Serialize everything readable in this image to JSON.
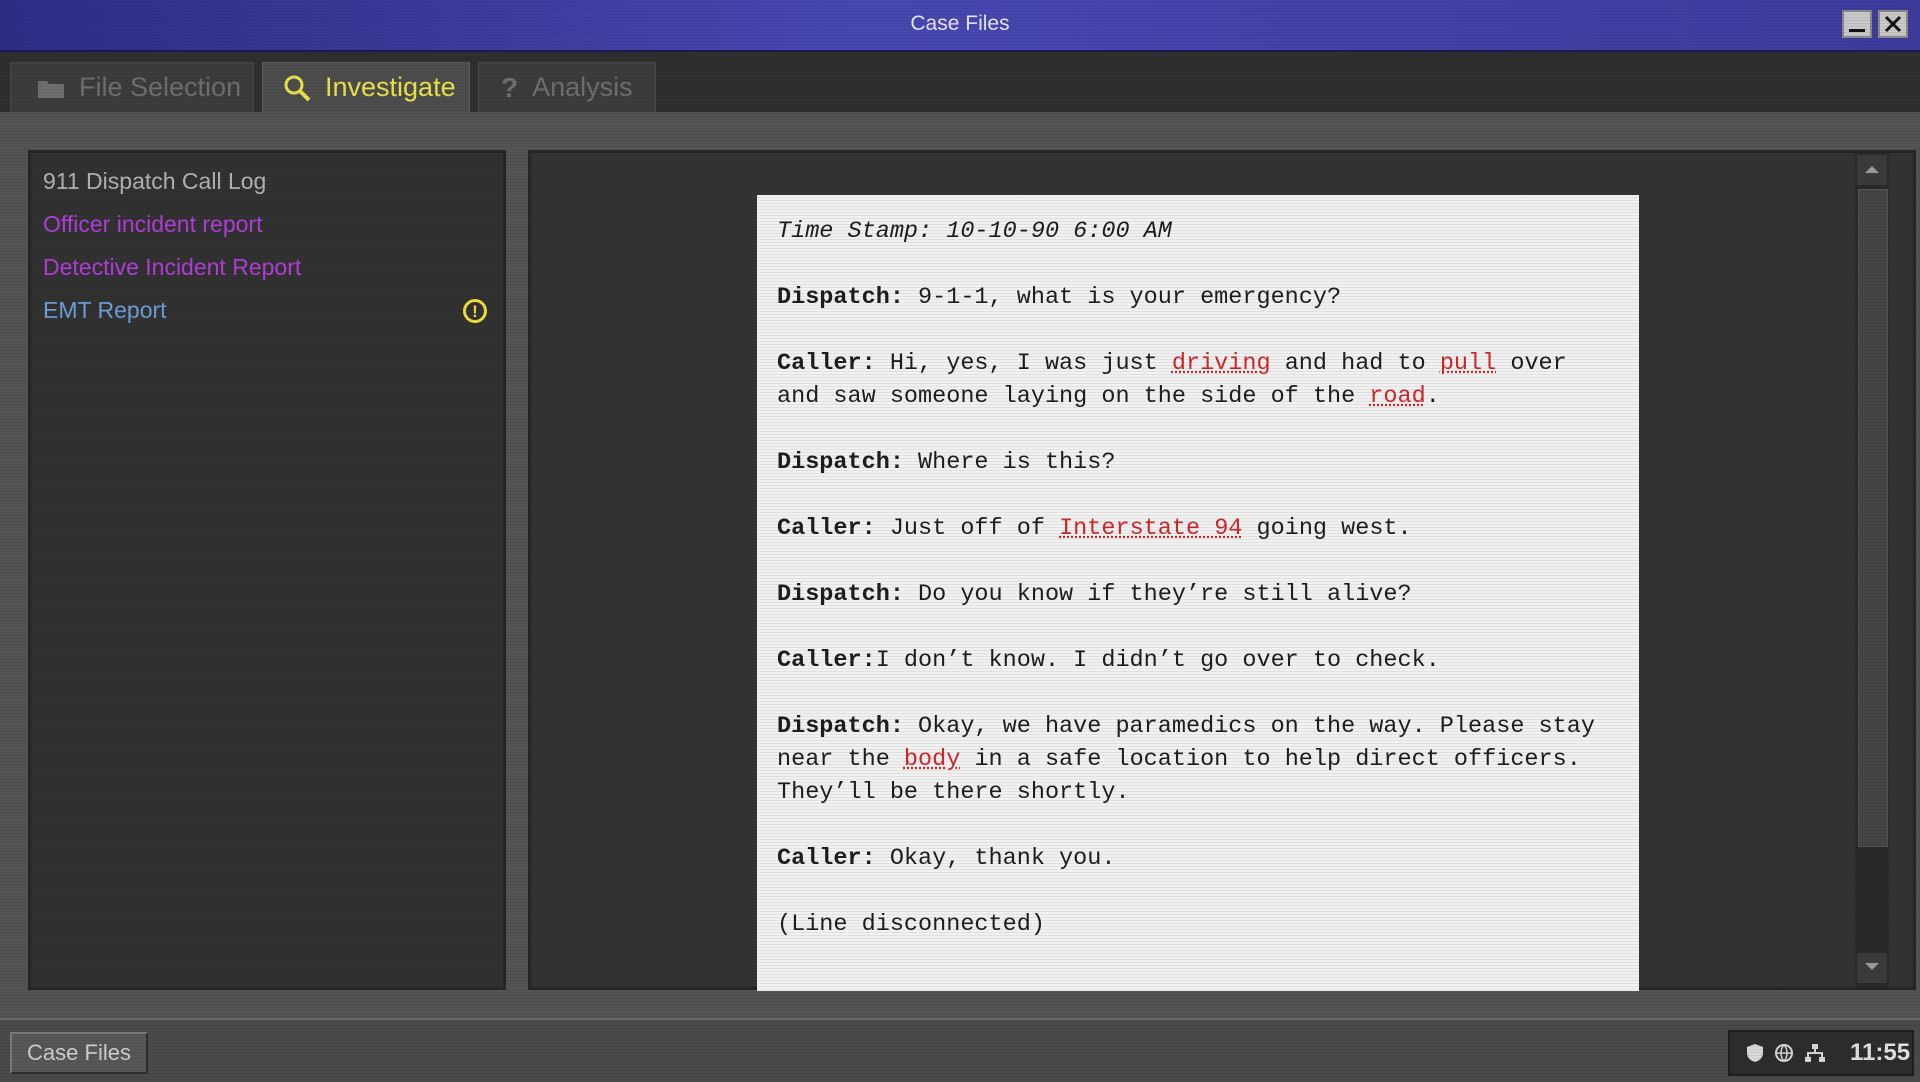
{
  "window": {
    "title": "Case Files"
  },
  "tabs": [
    {
      "label": "File Selection",
      "icon": "folder-icon",
      "active": false
    },
    {
      "label": "Investigate",
      "icon": "magnifier-icon",
      "active": true
    },
    {
      "label": "Analysis",
      "icon": "question-icon",
      "active": false
    }
  ],
  "files": [
    {
      "label": "911 Dispatch Call Log",
      "color": "#b3b3b3"
    },
    {
      "label": "Officer incident report",
      "color": "#b23ed8"
    },
    {
      "label": "Detective Incident Report",
      "color": "#b23ed8"
    },
    {
      "label": "EMT Report",
      "color": "#6f9fd8",
      "alert": "!"
    }
  ],
  "document": {
    "timestamp": "Time Stamp: 10-10-90 6:00 AM",
    "lines": [
      {
        "speaker": "Dispatch:",
        "parts": [
          " 9-1-1, what is your emergency?"
        ]
      },
      {
        "speaker": "Caller:",
        "parts": [
          " Hi, yes, I was just ",
          "driving",
          " and had to ",
          "pull",
          " over and saw someone laying on the side of the ",
          "road",
          "."
        ]
      },
      {
        "speaker": "Dispatch:",
        "parts": [
          " Where is this?"
        ]
      },
      {
        "speaker": "Caller:",
        "parts": [
          " Just off of ",
          "Interstate 94",
          " going west."
        ]
      },
      {
        "speaker": "Dispatch:",
        "parts": [
          " Do you know if they’re still alive?"
        ]
      },
      {
        "speaker": "Caller:",
        "parts": [
          "I don’t know. I didn’t go over to check."
        ]
      },
      {
        "speaker": "Dispatch:",
        "parts": [
          " Okay, we have paramedics on the way. Please stay near the ",
          "body",
          " in a safe location to help direct officers. They’ll be there shortly."
        ]
      },
      {
        "speaker": "Caller:",
        "parts": [
          " Okay, thank you."
        ]
      }
    ],
    "closing": "(Line disconnected)",
    "highlight_color": "#d1262a"
  },
  "taskbar": {
    "button_label": "Case Files",
    "tray_icons": [
      "shield-icon",
      "globe-icon",
      "network-icon"
    ],
    "clock": "11:55"
  },
  "colors": {
    "titlebar": "#3d3c9e",
    "active_tab_text": "#ece34a",
    "alert": "#ecdf39"
  }
}
